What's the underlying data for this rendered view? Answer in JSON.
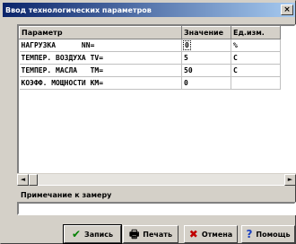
{
  "window": {
    "title": "Ввод технологических параметров",
    "close_glyph": "×"
  },
  "table": {
    "headers": [
      "Параметр",
      "Значение",
      "Ед.изм."
    ],
    "rows": [
      {
        "param": "НАГРУЗКА      NN=",
        "value": "0",
        "unit": "%"
      },
      {
        "param": "ТЕМПЕР. ВОЗДУХА TV=",
        "value": "5",
        "unit": "С"
      },
      {
        "param": "ТЕМПЕР. МАСЛА   TM=",
        "value": "50",
        "unit": "С"
      },
      {
        "param": "КОЭФФ. МОЩНОСТИ KM=",
        "value": "0",
        "unit": ""
      }
    ]
  },
  "scroll": {
    "left_glyph": "◄",
    "right_glyph": "►"
  },
  "note": {
    "label": "Примечание к замеру",
    "value": ""
  },
  "buttons": {
    "record": {
      "label": "Запись",
      "icon": "check-icon",
      "glyph": "✔"
    },
    "print": {
      "label": "Печать",
      "icon": "printer-icon",
      "glyph": "🖶"
    },
    "cancel": {
      "label": "Отмена",
      "icon": "cross-icon",
      "glyph": "✖"
    },
    "help": {
      "label": "Помощь",
      "icon": "help-icon",
      "glyph": "?"
    }
  }
}
